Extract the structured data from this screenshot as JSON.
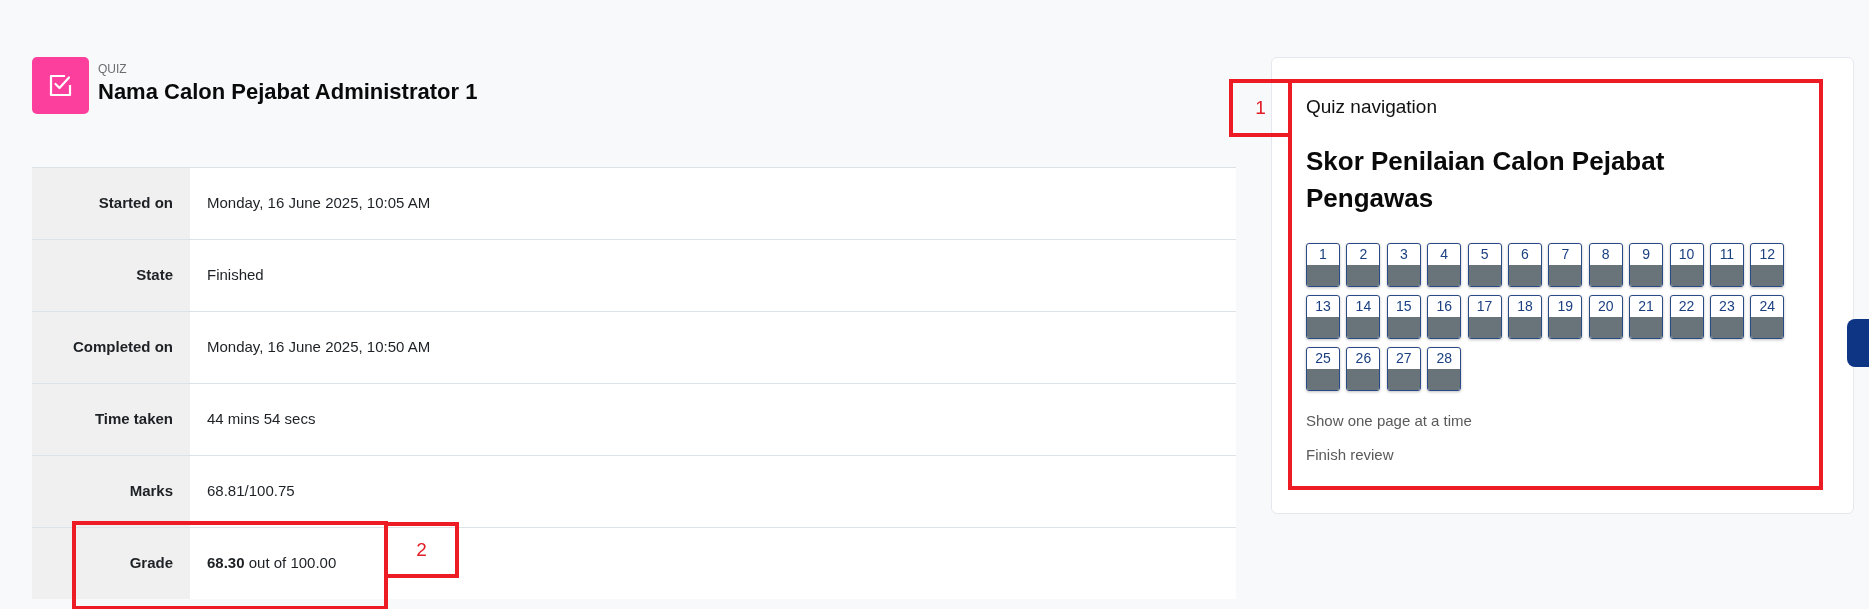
{
  "header": {
    "module_type": "QUIZ",
    "title": "Nama Calon Pejabat Administrator 1"
  },
  "summary": {
    "rows": [
      {
        "label": "Started on",
        "value": "Monday, 16 June 2025, 10:05 AM"
      },
      {
        "label": "State",
        "value": "Finished"
      },
      {
        "label": "Completed on",
        "value": "Monday, 16 June 2025, 10:50 AM"
      },
      {
        "label": "Time taken",
        "value": "44 mins 54 secs"
      },
      {
        "label": "Marks",
        "value": "68.81/100.75"
      },
      {
        "label": "Grade",
        "value": "**68.30** out of 100.00",
        "annotation": "2"
      }
    ]
  },
  "quiz_navigation": {
    "title": "Quiz navigation",
    "annotation": "1",
    "quiz_name": "Skor Penilaian Calon Pejabat Pengawas",
    "questions": [
      {
        "label": "1",
        "color": "#68737a"
      },
      {
        "label": "2",
        "color": "#68737a"
      },
      {
        "label": "3",
        "color": "#68737a"
      },
      {
        "label": "4",
        "color": "#68737a"
      },
      {
        "label": "5",
        "color": "#68737a"
      },
      {
        "label": "6",
        "color": "#68737a"
      },
      {
        "label": "7",
        "color": "#68737a"
      },
      {
        "label": "8",
        "color": "#68737a"
      },
      {
        "label": "9",
        "color": "#68737a"
      },
      {
        "label": "10",
        "color": "#68737a"
      },
      {
        "label": "11",
        "color": "#68737a"
      },
      {
        "label": "12",
        "color": "#68737a"
      },
      {
        "label": "13",
        "color": "#68737a"
      },
      {
        "label": "14",
        "color": "#68737a"
      },
      {
        "label": "15",
        "color": "#68737a"
      },
      {
        "label": "16",
        "color": "#68737a"
      },
      {
        "label": "17",
        "color": "#68737a"
      },
      {
        "label": "18",
        "color": "#68737a"
      },
      {
        "label": "19",
        "color": "#68737a"
      },
      {
        "label": "20",
        "color": "#68737a"
      },
      {
        "label": "21",
        "color": "#68737a"
      },
      {
        "label": "22",
        "color": "#68737a"
      },
      {
        "label": "23",
        "color": "#68737a"
      },
      {
        "label": "24",
        "color": "#68737a"
      },
      {
        "label": "25",
        "color": "#68737a"
      },
      {
        "label": "26",
        "color": "#68737a"
      },
      {
        "label": "27",
        "color": "#68737a"
      },
      {
        "label": "28",
        "color": "#68737a"
      }
    ],
    "links": [
      "Show one page at a time",
      "Finish review"
    ]
  }
}
